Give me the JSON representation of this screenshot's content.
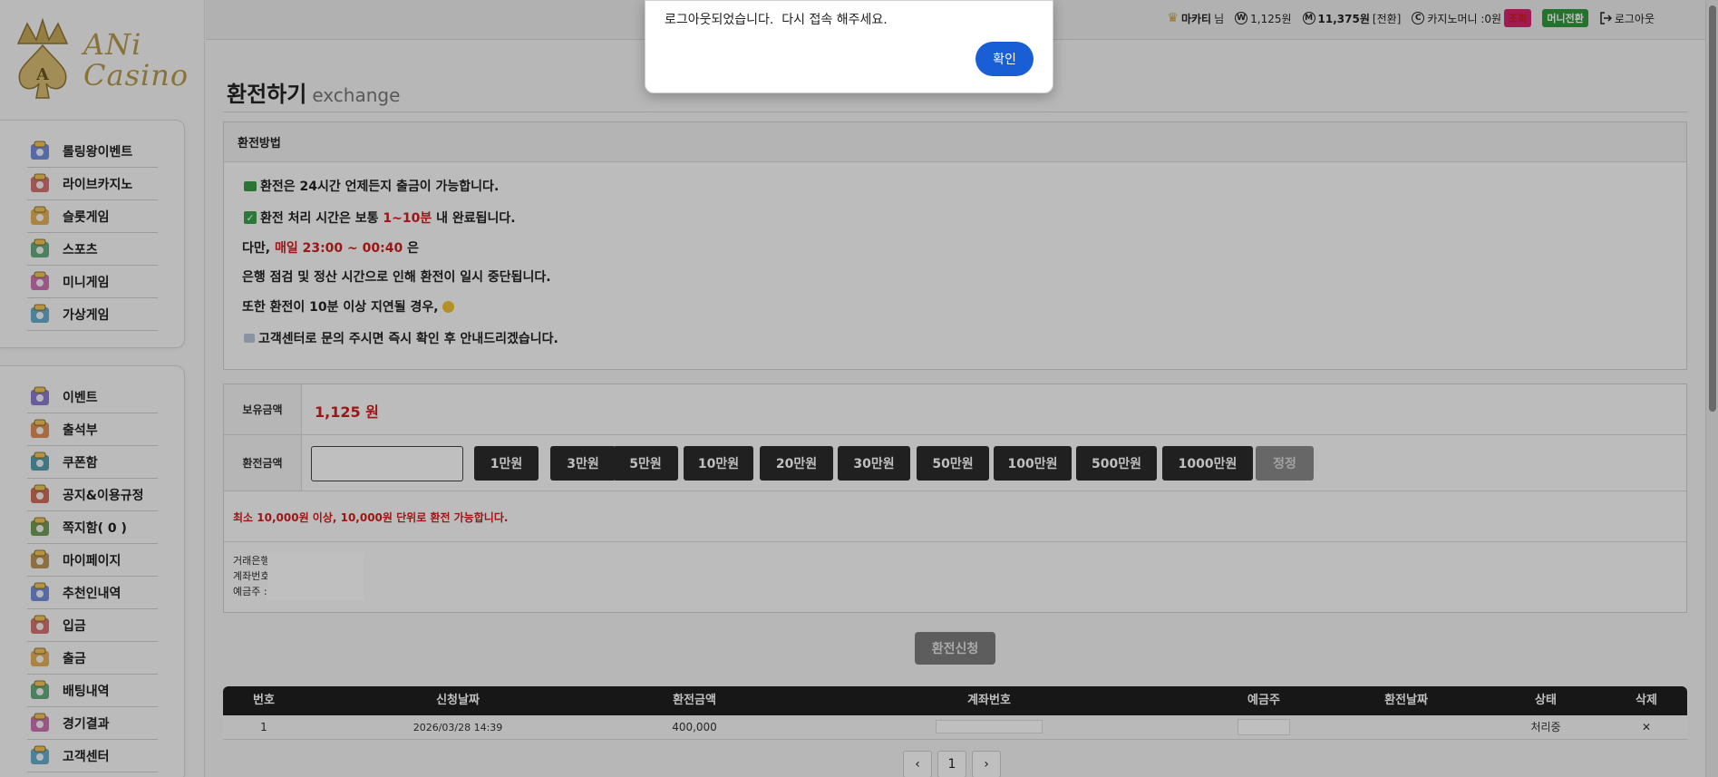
{
  "logo": {
    "line1": "ANi",
    "line2": "Casino"
  },
  "sidebar_top": [
    {
      "label": "롤링왕이벤트",
      "icon": "trophy-icon"
    },
    {
      "label": "라이브카지노",
      "icon": "casino-table-icon"
    },
    {
      "label": "슬롯게임",
      "icon": "slot-machine-icon"
    },
    {
      "label": "스포츠",
      "icon": "stadium-icon"
    },
    {
      "label": "미니게임",
      "icon": "gamepad-icon"
    },
    {
      "label": "가상게임",
      "icon": "vr-player-icon"
    }
  ],
  "sidebar_bottom": [
    {
      "label": "이벤트",
      "icon": "event-building-icon"
    },
    {
      "label": "출석부",
      "icon": "calendar-icon"
    },
    {
      "label": "쿠폰함",
      "icon": "coupon-icon"
    },
    {
      "label": "공지&이용규정",
      "icon": "megaphone-icon"
    },
    {
      "label": "쪽지함( 0 )",
      "icon": "mailbox-icon"
    },
    {
      "label": "마이페이지",
      "icon": "profile-card-icon"
    },
    {
      "label": "추천인내역",
      "icon": "referral-people-icon"
    },
    {
      "label": "입금",
      "icon": "bank-icon"
    },
    {
      "label": "출금",
      "icon": "money-bag-icon"
    },
    {
      "label": "배팅내역",
      "icon": "betting-slip-icon"
    },
    {
      "label": "경기결과",
      "icon": "bar-chart-icon"
    },
    {
      "label": "고객센터",
      "icon": "support-agent-icon"
    }
  ],
  "topbar": {
    "username": "마카티",
    "username_suffix": "님",
    "balance": "1,125원",
    "point": "11,375원",
    "point_action": "[전환]",
    "casino_money": "카지노머니 :0원",
    "lookup_label": "조회",
    "mini_convert_label": "머니전환",
    "logout_label": "로그아웃"
  },
  "page": {
    "title": "환전하기",
    "subtitle": "exchange"
  },
  "method": {
    "heading": "환전방법",
    "lines": {
      "l1": "환전은 24시간 언제든지 출금이 가능합니다.",
      "l2_pre": "환전 처리 시간은 보통 ",
      "l2_red": "1~10분",
      "l2_post": " 내 완료됩니다.",
      "l3_pre": "다만, ",
      "l3_red": "매일 23:00 ~ 00:40",
      "l3_post": " 은",
      "l4": "은행 점검 및 정산 시간으로 인해 환전이 일시 중단됩니다.",
      "l5": "또한 환전이 10분 이상 지연될 경우,",
      "l6": "고객센터로 문의 주시면 즉시 확인 후 안내드리겠습니다."
    }
  },
  "form": {
    "balance_label": "보유금액",
    "balance_value": "1,125 원",
    "amount_label": "환전금액",
    "amount_value": "",
    "chips": [
      "1만원",
      "3만원",
      "5만원",
      "10만원",
      "20만원",
      "30만원",
      "50만원",
      "100만원",
      "500만원",
      "1000만원"
    ],
    "reset_label": "정정",
    "notice": "최소 10,000원 이상, 10,000원  단위로 환전 가능합니다.",
    "bank_label": "거래은행 :",
    "account_label": "계좌번호 :",
    "holder_label": "예금주 :",
    "apply_label": "환전신청"
  },
  "table": {
    "headers": [
      "번호",
      "신청날짜",
      "환전금액",
      "계좌번호",
      "예금주",
      "환전날짜",
      "상태",
      "삭제"
    ],
    "row": {
      "no": "1",
      "date": "2026/03/28 14:39",
      "amount": "400,000",
      "exchange_date": "",
      "status": "처리중",
      "delete": "✕"
    }
  },
  "pager": {
    "prev": "‹",
    "page": "1",
    "next": "›"
  },
  "modal": {
    "message": "로그아웃되었습니다.  다시 접속 해주세요.",
    "ok_label": "확인"
  }
}
